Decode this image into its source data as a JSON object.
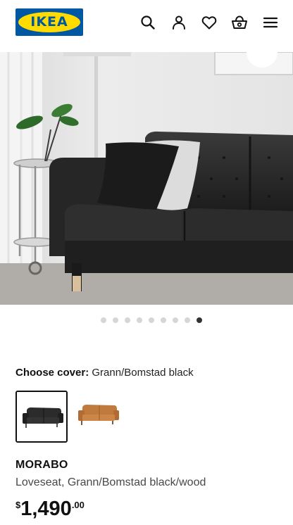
{
  "header": {
    "logo_text": "IKEA",
    "icons": [
      "search-icon",
      "profile-icon",
      "heart-icon",
      "basket-icon",
      "menu-icon"
    ]
  },
  "hero": {
    "image_alt": "Black leather loveseat in living room",
    "dots_count": 9,
    "active_dot": 9
  },
  "cover": {
    "label": "Choose cover:",
    "value": "Grann/Bomstad black",
    "options": [
      {
        "name": "Grann/Bomstad black",
        "color": "#2b2b2b",
        "selected": true
      },
      {
        "name": "Grann/Bomstad golden-brown",
        "color": "#c07a3e",
        "selected": false
      }
    ]
  },
  "product": {
    "name": "MORABO",
    "description": "Loveseat, Grann/Bomstad black/wood",
    "price": {
      "currency": "$",
      "main": "1,490",
      "cents": ".00"
    }
  },
  "colors": {
    "ikea_blue": "#0058a3",
    "ikea_yellow": "#ffdb00",
    "sofa_black": "#2b2b2b",
    "active_dot": "#333333"
  }
}
